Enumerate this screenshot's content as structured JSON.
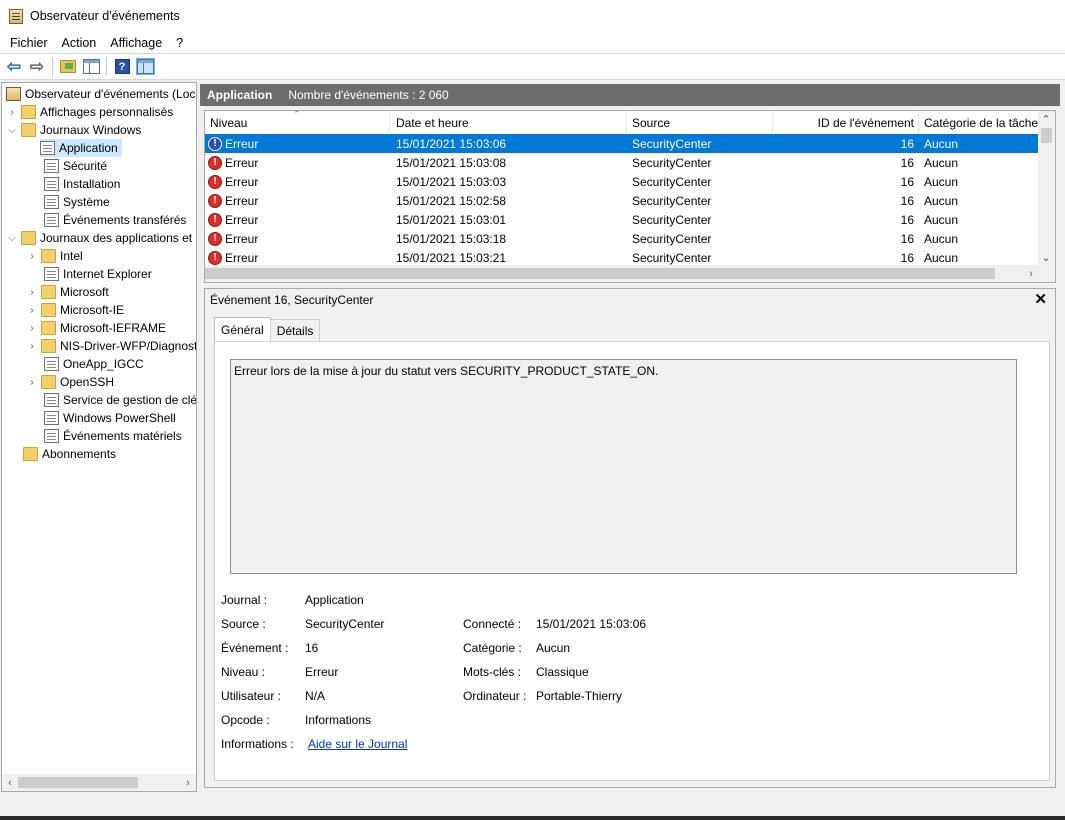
{
  "window": {
    "title": "Observateur d'événements"
  },
  "menu": [
    "Fichier",
    "Action",
    "Affichage",
    "?"
  ],
  "tree": {
    "root": "Observateur d'événements (Local)",
    "custom_views": "Affichages personnalisés",
    "windows_logs": "Journaux Windows",
    "windows_children": [
      "Application",
      "Sécurité",
      "Installation",
      "Système",
      "Événements transférés"
    ],
    "apps_logs": "Journaux des applications et des services",
    "apps_children": [
      "Intel",
      "Internet Explorer",
      "Microsoft",
      "Microsoft-IE",
      "Microsoft-IEFRAME",
      "NIS-Driver-WFP/Diagnostic",
      "OneApp_IGCC",
      "OpenSSH",
      "Service de gestion de clés",
      "Windows PowerShell",
      "Événements matériels"
    ],
    "subscriptions": "Abonnements"
  },
  "list_header": {
    "title": "Application",
    "count_text": "Nombre d'événements : 2 060"
  },
  "columns": [
    "Niveau",
    "Date et heure",
    "Source",
    "ID de l'événement",
    "Catégorie de la tâche"
  ],
  "events": [
    {
      "level": "Erreur",
      "datetime": "15/01/2021 15:03:06",
      "source": "SecurityCenter",
      "id": "16",
      "category": "Aucun"
    },
    {
      "level": "Erreur",
      "datetime": "15/01/2021 15:03:08",
      "source": "SecurityCenter",
      "id": "16",
      "category": "Aucun"
    },
    {
      "level": "Erreur",
      "datetime": "15/01/2021 15:03:03",
      "source": "SecurityCenter",
      "id": "16",
      "category": "Aucun"
    },
    {
      "level": "Erreur",
      "datetime": "15/01/2021 15:02:58",
      "source": "SecurityCenter",
      "id": "16",
      "category": "Aucun"
    },
    {
      "level": "Erreur",
      "datetime": "15/01/2021 15:03:01",
      "source": "SecurityCenter",
      "id": "16",
      "category": "Aucun"
    },
    {
      "level": "Erreur",
      "datetime": "15/01/2021 15:03:18",
      "source": "SecurityCenter",
      "id": "16",
      "category": "Aucun"
    },
    {
      "level": "Erreur",
      "datetime": "15/01/2021 15:03:21",
      "source": "SecurityCenter",
      "id": "16",
      "category": "Aucun"
    }
  ],
  "detail": {
    "title": "Événement 16, SecurityCenter",
    "tabs": [
      "Général",
      "Détails"
    ],
    "description": "Erreur lors de la mise à jour du statut  vers SECURITY_PRODUCT_STATE_ON.",
    "labels": {
      "journal": "Journal :",
      "source": "Source :",
      "event": "Événement :",
      "level": "Niveau :",
      "user": "Utilisateur :",
      "opcode": "Opcode :",
      "info": "Informations :",
      "logged": "Connecté :",
      "category": "Catégorie :",
      "keywords": "Mots-clés :",
      "computer": "Ordinateur :"
    },
    "values": {
      "journal": "Application",
      "source": "SecurityCenter",
      "event": "16",
      "level": "Erreur",
      "user": "N/A",
      "opcode": "Informations",
      "info": "Aide sur le Journal",
      "logged": "15/01/2021 15:03:06",
      "category": "Aucun",
      "keywords": "Classique",
      "computer": "Portable-Thierry"
    }
  },
  "colors": {
    "selection": "#0078d7",
    "header_bar": "#6d6d6d",
    "link": "#0033cc",
    "error_icon": "#d8302b"
  }
}
